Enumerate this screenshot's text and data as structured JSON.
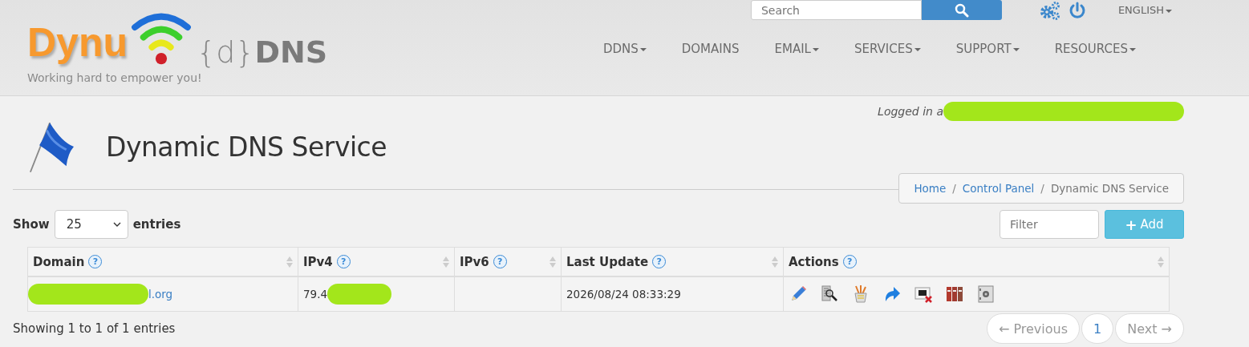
{
  "header": {
    "logo": {
      "brand": "Dynu",
      "product_brace": "{d}",
      "product": "DNS",
      "tagline": "Working hard to empower you!"
    },
    "search": {
      "placeholder": "Search"
    },
    "language": "ENGLISH",
    "nav": [
      {
        "label": "DDNS",
        "dropdown": true
      },
      {
        "label": "DOMAINS",
        "dropdown": false
      },
      {
        "label": "EMAIL",
        "dropdown": true
      },
      {
        "label": "SERVICES",
        "dropdown": true
      },
      {
        "label": "SUPPORT",
        "dropdown": true
      },
      {
        "label": "RESOURCES",
        "dropdown": true
      }
    ]
  },
  "login": {
    "text": "Logged in a",
    "redacted": true
  },
  "page_title": "Dynamic DNS Service",
  "breadcrumb": [
    {
      "label": "Home",
      "link": true
    },
    {
      "separator": "/",
      "label": "Control Panel",
      "link": true
    },
    {
      "separator": "/",
      "label": "Dynamic DNS Service",
      "link": false
    }
  ],
  "length_menu": {
    "label_before": "Show",
    "value": "25",
    "label_after": "entries"
  },
  "filter": {
    "placeholder": "Filter"
  },
  "add_button": {
    "icon": "+",
    "label": "Add"
  },
  "table": {
    "columns": [
      {
        "label": "Domain",
        "help": "?",
        "sortable": true
      },
      {
        "label": "IPv4",
        "help": "?",
        "sortable": true
      },
      {
        "label": "IPv6",
        "help": "?",
        "sortable": true
      },
      {
        "label": "Last Update",
        "help": "?",
        "sortable": true
      },
      {
        "label": "Actions",
        "help": "?",
        "sortable": true
      }
    ],
    "rows": [
      {
        "domain": {
          "text": "l.org",
          "redacted": true
        },
        "ipv4": {
          "text": "79.4",
          "redacted": true
        },
        "last_update": "2026/08/24 08:33:29"
      }
    ]
  },
  "info": "Showing 1 to 1 of 1 entries",
  "pagination": [
    {
      "label": "← Previous",
      "selected": false,
      "disabled": true
    },
    {
      "label": "1",
      "selected": true,
      "disabled": false
    },
    {
      "label": "Next →",
      "selected": false,
      "disabled": true
    }
  ]
}
